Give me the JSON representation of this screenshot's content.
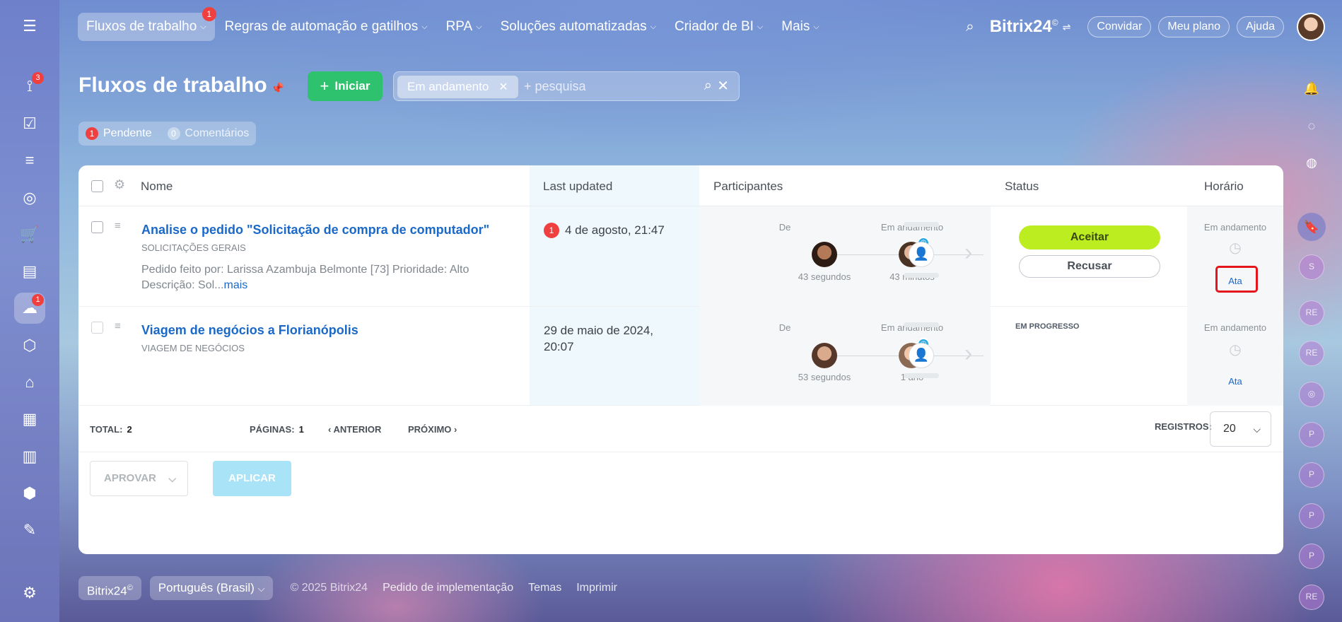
{
  "topnav": {
    "items": [
      {
        "label": "Fluxos de trabalho",
        "badge": "1"
      },
      {
        "label": "Regras de automação e gatilhos"
      },
      {
        "label": "RPA"
      },
      {
        "label": "Soluções automatizadas"
      },
      {
        "label": "Criador de BI"
      },
      {
        "label": "Mais"
      }
    ],
    "brand": "Bitrix24",
    "brand_mark": "©",
    "invite": "Convidar",
    "plan": "Meu plano",
    "help": "Ajuda"
  },
  "sidebar": {
    "badges": {
      "flows": "3",
      "automation": "1"
    }
  },
  "page": {
    "title": "Fluxos de trabalho",
    "start_button": "Iniciar",
    "filter_chip": "Em andamento",
    "search_placeholder": "+ pesquisa",
    "counters": {
      "pending_count": "1",
      "pending_label": "Pendente",
      "comments_count": "0",
      "comments_label": "Comentários"
    }
  },
  "grid": {
    "headers": {
      "name": "Nome",
      "last_updated": "Last updated",
      "participants": "Participantes",
      "status": "Status",
      "time": "Horário"
    },
    "rows": [
      {
        "title": "Analise o pedido \"Solicitação de compra de computador\"",
        "category": "SOLICITAÇÕES GERAIS",
        "desc_line1": "Pedido feito por: Larissa Azambuja Belmonte [73] Prioridade: Alto",
        "desc_line2": "Descrição: Sol...",
        "more": "mais",
        "date_badge": "1",
        "date": "4 de agosto, 21:47",
        "from_label": "De",
        "from_time": "43 segundos",
        "progress_label": "Em andamento",
        "progress_time": "43 minutos",
        "accept": "Aceitar",
        "decline": "Recusar",
        "time_label": "Em andamento",
        "time_link": "Ata"
      },
      {
        "title": "Viagem de negócios a Florianópolis",
        "category": "VIAGEM DE NEGÓCIOS",
        "date_line1": "29 de maio de 2024,",
        "date_line2": "20:07",
        "from_label": "De",
        "from_time": "53 segundos",
        "progress_label": "Em andamento",
        "progress_time": "1 ano",
        "status": "EM PROGRESSO",
        "time_label": "Em andamento",
        "time_link": "Ata"
      }
    ]
  },
  "pager": {
    "total_label": "TOTAL:",
    "total": "2",
    "pages_label": "PÁGINAS:",
    "page": "1",
    "prev": "ANTERIOR",
    "next": "PRÓXIMO",
    "records_label": "REGISTROS:",
    "records": "20"
  },
  "bulk": {
    "action": "APROVAR",
    "apply": "APLICAR"
  },
  "footer": {
    "brand": "Bitrix24",
    "brand_mark": "©",
    "language": "Português (Brasil)",
    "copyright": "© 2025 Bitrix24",
    "links": [
      "Pedido de implementação",
      "Temas",
      "Imprimir"
    ]
  },
  "rightbar": {
    "avatars": [
      "S",
      "RE",
      "RE",
      "P",
      "P",
      "P",
      "P",
      "RE"
    ]
  },
  "colors": {
    "accent_green": "#2fc26e",
    "accept_lime": "#bbed21",
    "link_blue": "#1a68c8",
    "badge_red": "#f03f3f",
    "highlight_red": "#e5161b"
  }
}
